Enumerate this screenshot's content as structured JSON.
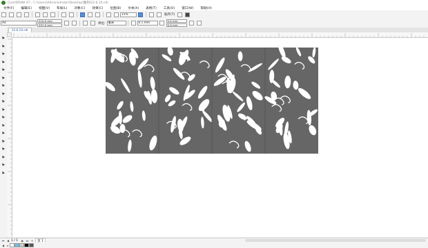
{
  "window": {
    "title": "CorelDRAW X7 - C:\\Users\\Administrator\\Desktop\\雕刻\\22.6.10.cdr"
  },
  "menu": [
    "文件(F)",
    "编辑(E)",
    "视图(V)",
    "布局(L)",
    "对象(C)",
    "效果(C)",
    "位图(B)",
    "文本(X)",
    "表格(T)",
    "工具(O)",
    "窗口(W)",
    "帮助(H)"
  ],
  "toolbar": {
    "zoom": "15%",
    "snap_label": "贴齐(T)"
  },
  "propbar": {
    "page_size": "A4",
    "width": "210.0 mm",
    "height": "297.0 mm",
    "units_label": "单位:",
    "units": "毫米",
    "nudge": "0.1 mm",
    "dup_x": "5.0 mm",
    "dup_y": "5.0 mm"
  },
  "document": {
    "tab": "22.6.10.cdr"
  },
  "statusbar": {
    "page_counter": "1 / 1",
    "page_tab": "页 1"
  },
  "colors": {
    "panel": "#666666",
    "pattern": "#ffffff"
  }
}
